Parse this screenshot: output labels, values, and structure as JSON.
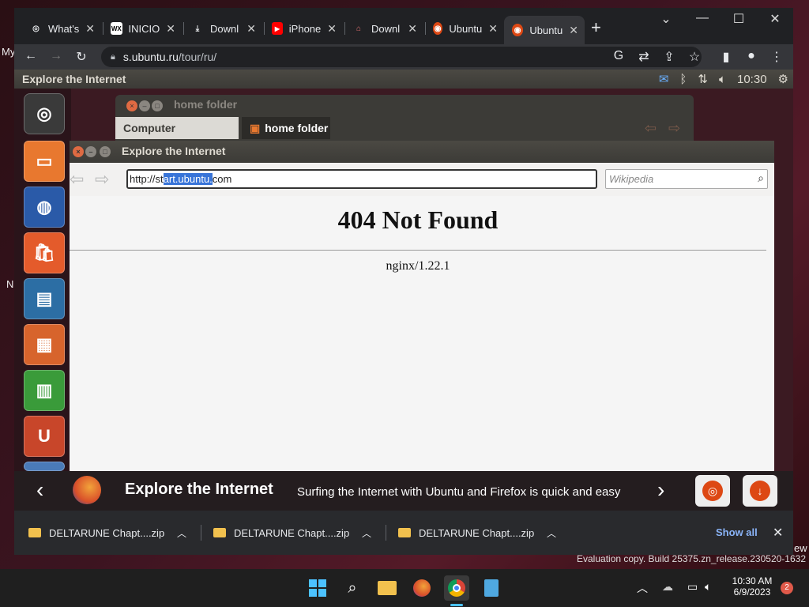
{
  "desktop": {
    "edge_text_top": "My",
    "edge_text_left": "N",
    "edge_text_right": "ew"
  },
  "chrome": {
    "tabs": [
      {
        "label": "What's",
        "icon": "chrome-icon"
      },
      {
        "label": "INICIO",
        "icon": "wix-icon"
      },
      {
        "label": "Downl",
        "icon": "download-icon"
      },
      {
        "label": "iPhone",
        "icon": "youtube-icon"
      },
      {
        "label": "Downl",
        "icon": "store-icon"
      },
      {
        "label": "Ubuntu",
        "icon": "ubuntu-icon"
      },
      {
        "label": "Ubuntu",
        "icon": "ubuntu-icon",
        "active": true
      }
    ],
    "new_tab": "+",
    "address": {
      "host": "s.ubuntu.ru",
      "path": "/tour/ru/"
    }
  },
  "tour": {
    "panel_title": "Explore the Internet",
    "panel_time": "10:30",
    "home_folder_title": "home folder",
    "home_folder_sidebar": "Computer",
    "home_folder_tab": "home folder",
    "firefox_title": "Explore the Internet",
    "url": {
      "before": "http://st",
      "selected": "art.ubuntu.",
      "after": "com"
    },
    "search_placeholder": "Wikipedia",
    "page_heading": "404 Not Found",
    "page_footer": "nginx/1.22.1",
    "bar_title": "Explore the Internet",
    "bar_desc": "Surfing the Internet with Ubuntu and Firefox is quick and easy"
  },
  "downloads": {
    "items": [
      "DELTARUNE Chapt....zip",
      "DELTARUNE Chapt....zip",
      "DELTARUNE Chapt....zip"
    ],
    "show_all": "Show all"
  },
  "watermark": "Evaluation copy. Build 25375.zn_release.230520-1632",
  "taskbar": {
    "time": "10:30 AM",
    "date": "6/9/2023",
    "badge": "2"
  },
  "colors": {
    "ubuntu_orange": "#dd4814",
    "selection": "#3874d8"
  }
}
